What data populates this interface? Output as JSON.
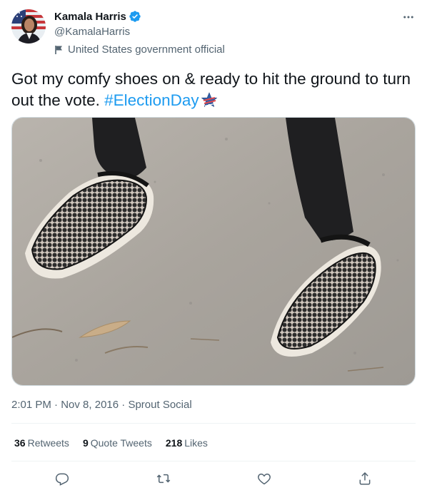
{
  "author": {
    "name": "Kamala Harris",
    "handle": "@KamalaHarris",
    "label": "United States government official"
  },
  "tweet": {
    "text": "Got my comfy shoes on & ready to hit the ground to turn out the vote. ",
    "hashtag": "#ElectionDay"
  },
  "meta": {
    "time": "2:01 PM",
    "sep1": " · ",
    "date": "Nov 8, 2016",
    "sep2": " · ",
    "source": "Sprout Social"
  },
  "stats": {
    "retweets_count": "36",
    "retweets_label": "Retweets",
    "quotes_count": "9",
    "quotes_label": "Quote Tweets",
    "likes_count": "218",
    "likes_label": "Likes"
  },
  "icons": {
    "verified": "verified-badge-icon",
    "more": "more-options-icon",
    "label": "flag-icon",
    "reply": "reply-icon",
    "retweet": "retweet-icon",
    "like": "heart-icon",
    "share": "share-icon"
  },
  "colors": {
    "accent": "#1d9bf0",
    "text": "#0f1419",
    "secondary": "#536471",
    "border": "#cfd9de"
  }
}
